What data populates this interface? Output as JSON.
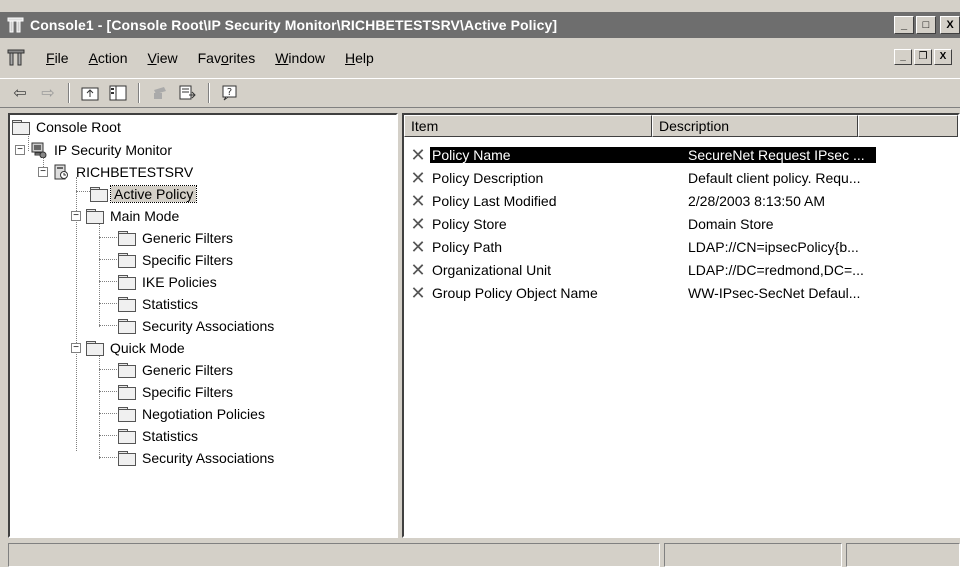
{
  "window": {
    "title": "Console1 - [Console Root\\IP Security Monitor\\RICHBETESTSRV\\Active Policy]",
    "minimize": "_",
    "maximize": "□",
    "close": "X",
    "mdi_minimize": "_",
    "mdi_restore": "❐",
    "mdi_close": "X"
  },
  "menu": [
    {
      "label": "File",
      "key": "F"
    },
    {
      "label": "Action",
      "key": "A"
    },
    {
      "label": "View",
      "key": "V"
    },
    {
      "label": "Favorites",
      "key": "o"
    },
    {
      "label": "Window",
      "key": "W"
    },
    {
      "label": "Help",
      "key": "H"
    }
  ],
  "toolbar": {
    "icons": [
      "back-arrow-icon",
      "forward-arrow-icon",
      "up-one-level-icon",
      "show-hide-console-tree-icon",
      "delete-icon",
      "export-list-icon",
      "help-icon"
    ]
  },
  "tree": {
    "root": "Console Root",
    "monitor": "IP Security Monitor",
    "server": "RICHBETESTSRV",
    "active_policy": "Active Policy",
    "main_mode": "Main Mode",
    "main_mode_children": [
      "Generic Filters",
      "Specific Filters",
      "IKE Policies",
      "Statistics",
      "Security Associations"
    ],
    "quick_mode": "Quick Mode",
    "quick_mode_children": [
      "Generic Filters",
      "Specific Filters",
      "Negotiation Policies",
      "Statistics",
      "Security Associations"
    ]
  },
  "list": {
    "columns": [
      "Item",
      "Description"
    ],
    "rows": [
      {
        "item": "Policy Name",
        "description": "SecureNet Request IPsec ..."
      },
      {
        "item": "Policy Description",
        "description": "Default client policy.  Requ..."
      },
      {
        "item": "Policy Last Modified",
        "description": "2/28/2003 8:13:50 AM"
      },
      {
        "item": "Policy Store",
        "description": "Domain Store"
      },
      {
        "item": "Policy Path",
        "description": "LDAP://CN=ipsecPolicy{b..."
      },
      {
        "item": "Organizational Unit",
        "description": "LDAP://DC=redmond,DC=..."
      },
      {
        "item": "Group Policy Object Name",
        "description": "WW-IPsec-SecNet Defaul..."
      }
    ]
  }
}
